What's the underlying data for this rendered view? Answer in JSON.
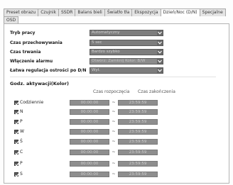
{
  "tabs_row1": [
    {
      "label": "Preset obrazu",
      "active": false
    },
    {
      "label": "Czujnik",
      "active": false
    },
    {
      "label": "SSDR",
      "active": false
    },
    {
      "label": "Balans bieli",
      "active": false
    },
    {
      "label": "Światło tła",
      "active": false
    },
    {
      "label": "Ekspozycja",
      "active": false
    },
    {
      "label": "Dzień/Noc (D/N)",
      "active": true
    },
    {
      "label": "Specjalne",
      "active": false
    }
  ],
  "tabs_row2": [
    {
      "label": "OSD",
      "active": false
    }
  ],
  "settings": [
    {
      "label": "Tryb pracy",
      "value": "Automatyczny",
      "disabled": false
    },
    {
      "label": "Czas przechowywania",
      "value": "5 sec",
      "disabled": false
    },
    {
      "label": "Czas trwania",
      "value": "Bardzo szybko",
      "disabled": false
    },
    {
      "label": "Włączenie alarmu",
      "value": "Otwórz: Zamknij Kolor: B/W",
      "disabled": true
    },
    {
      "label": "Łatwa regulacja ostrości po D/N",
      "value": "Wył.",
      "disabled": false
    }
  ],
  "schedule": {
    "title": "Godz. aktywacji(Kolor)",
    "start_header": "Czas rozpoczęcia",
    "end_header": "Czas zakończenia",
    "separator": "~",
    "rows": [
      {
        "day": "Codziennie",
        "checked": true,
        "start": "00:00:00",
        "end": "23:59:59"
      },
      {
        "day": "N",
        "checked": true,
        "start": "00:00:00",
        "end": "23:59:59"
      },
      {
        "day": "P",
        "checked": true,
        "start": "00:00:00",
        "end": "23:59:59"
      },
      {
        "day": "W",
        "checked": true,
        "start": "00:00:00",
        "end": "23:59:59"
      },
      {
        "day": "Ś",
        "checked": true,
        "start": "00:00:00",
        "end": "23:59:59"
      },
      {
        "day": "C",
        "checked": true,
        "start": "00:00:00",
        "end": "23:59:59"
      },
      {
        "day": "P",
        "checked": true,
        "start": "00:00:00",
        "end": "23:59:59"
      },
      {
        "day": "S",
        "checked": true,
        "start": "00:00:00",
        "end": "23:59:59"
      }
    ]
  },
  "colors": {
    "select_bg": "#7d7d7d",
    "disabled_field_bg": "#8e8e8e",
    "checkbox_bg": "#5a5a5a"
  },
  "icons": {
    "select_arrow": "chevron-down-icon",
    "checkbox": "checkmark-icon"
  }
}
